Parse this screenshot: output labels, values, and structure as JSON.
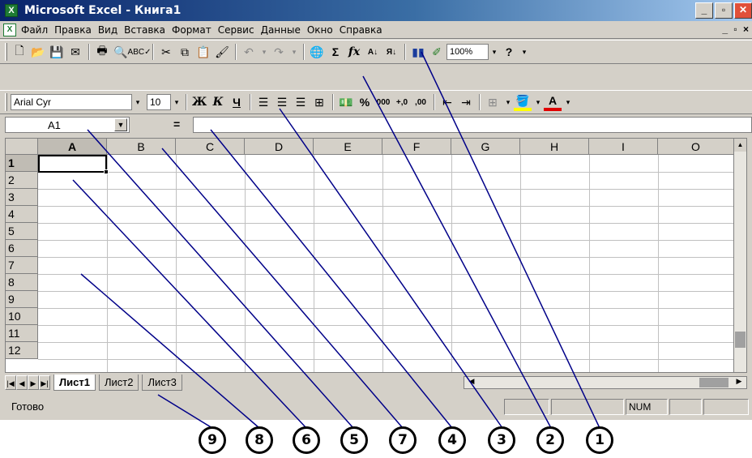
{
  "window": {
    "title": "Microsoft Excel - Книга1",
    "icon": "excel-app-icon",
    "controls": [
      "minimize",
      "maximize",
      "close"
    ]
  },
  "menubar": {
    "items": [
      "Файл",
      "Правка",
      "Вид",
      "Вставка",
      "Формат",
      "Сервис",
      "Данные",
      "Окно",
      "Справка"
    ],
    "doc_controls": "_ ▫ ×"
  },
  "standard_toolbar": {
    "zoom": "100%"
  },
  "formatting_toolbar": {
    "font_name": "Arial Cyr",
    "font_size": "10",
    "bold_label": "Ж",
    "italic_label": "К",
    "underline_label": "Ч",
    "percent_label": "%",
    "thousands_label": "000",
    "inc_decimal_label": "+,0",
    "dec_decimal_label": ",00"
  },
  "formula_bar": {
    "name_box": "A1",
    "equals": "=",
    "formula": ""
  },
  "grid": {
    "columns": [
      "A",
      "B",
      "C",
      "D",
      "E",
      "F",
      "G",
      "H",
      "I",
      "O"
    ],
    "rows": [
      "1",
      "2",
      "3",
      "4",
      "5",
      "6",
      "7",
      "8",
      "9",
      "10",
      "11",
      "12"
    ],
    "active_cell": "A1"
  },
  "sheets": {
    "tabs": [
      "Лист1",
      "Лист2",
      "Лист3"
    ],
    "active": "Лист1"
  },
  "statusbar": {
    "status": "Готово",
    "num_indicator": "NUM"
  },
  "callouts": [
    "9",
    "8",
    "6",
    "5",
    "7",
    "4",
    "3",
    "2",
    "1"
  ]
}
